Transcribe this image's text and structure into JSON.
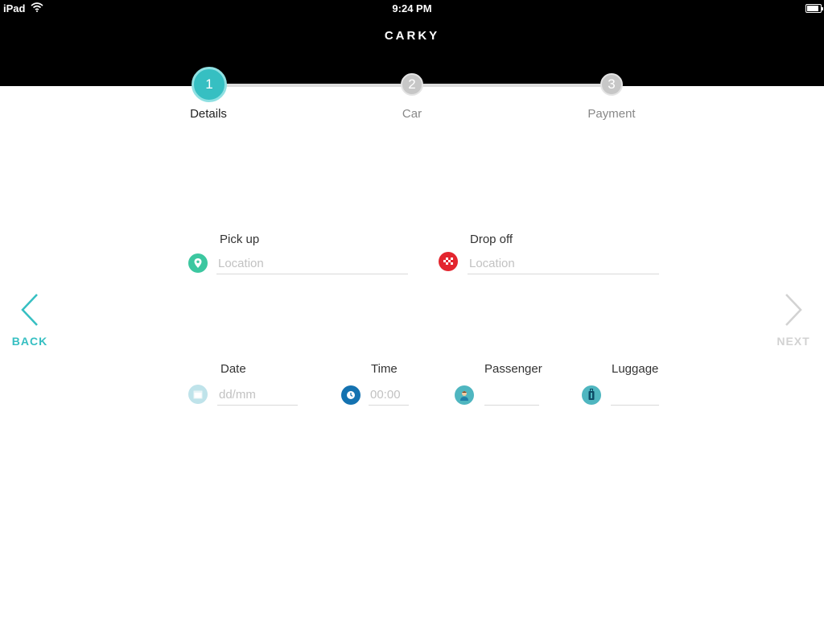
{
  "status_bar": {
    "device": "iPad",
    "time": "9:24 PM",
    "battery_level": 0.9
  },
  "header": {
    "logo_text": "CARKY"
  },
  "stepper": {
    "steps": [
      {
        "number": "1",
        "label": "Details",
        "active": true
      },
      {
        "number": "2",
        "label": "Car",
        "active": false
      },
      {
        "number": "3",
        "label": "Payment",
        "active": false
      }
    ]
  },
  "navigation": {
    "back_label": "BACK",
    "next_label": "NEXT"
  },
  "form": {
    "pickup": {
      "label": "Pick up",
      "placeholder": "Location",
      "value": "",
      "icon": "map-pin-icon"
    },
    "dropoff": {
      "label": "Drop off",
      "placeholder": "Location",
      "value": "",
      "icon": "checkered-flag-icon"
    },
    "date": {
      "label": "Date",
      "placeholder": "dd/mm",
      "value": "",
      "icon": "calendar-icon"
    },
    "time": {
      "label": "Time",
      "placeholder": "00:00",
      "value": "",
      "icon": "clock-icon"
    },
    "passenger": {
      "label": "Passenger",
      "placeholder": "",
      "value": "",
      "icon": "person-icon"
    },
    "luggage": {
      "label": "Luggage",
      "placeholder": "",
      "value": "",
      "icon": "suitcase-icon"
    }
  },
  "colors": {
    "accent": "#36bfc2",
    "pickup_icon": "#3cc7a0",
    "dropoff_icon": "#e3262f",
    "date_icon": "#bfe3ea",
    "time_icon": "#1472b0",
    "passenger_icon": "#4fb6c0",
    "luggage_icon": "#4fb6c0",
    "inactive": "#c7c7c7"
  }
}
